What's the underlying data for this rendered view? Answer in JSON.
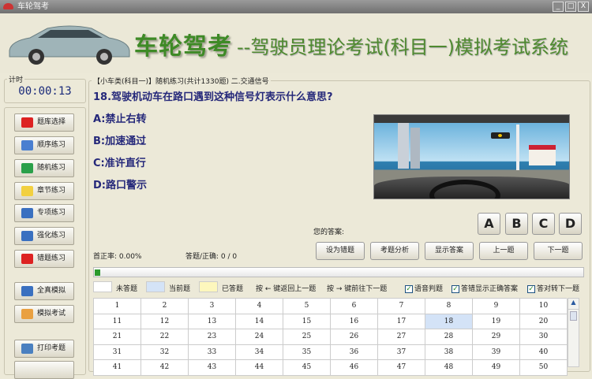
{
  "window": {
    "title": "车轮驾考",
    "min": "_",
    "max": "□",
    "close": "X"
  },
  "banner": {
    "brand": "车轮驾考",
    "subtitle": "--驾驶员理论考试(科目一)模拟考试系统"
  },
  "timer": {
    "label": "计时",
    "value": "00:00:13"
  },
  "sidebar": {
    "items": [
      {
        "label": "题库选择",
        "icon": "blocks-icon",
        "color": "#d22"
      },
      {
        "label": "顺序练习",
        "icon": "edit-icon",
        "color": "#4a7fd0"
      },
      {
        "label": "随机练习",
        "icon": "refresh-icon",
        "color": "#2aa04a"
      },
      {
        "label": "章节练习",
        "icon": "note-icon",
        "color": "#f2d040"
      },
      {
        "label": "专项练习",
        "icon": "checklist-icon",
        "color": "#3a70c0"
      },
      {
        "label": "强化练习",
        "icon": "chart-icon",
        "color": "#3a70c0"
      },
      {
        "label": "错题练习",
        "icon": "flag-icon",
        "color": "#d22"
      },
      {
        "label": "全真模拟",
        "icon": "chart-icon",
        "color": "#3a70c0"
      },
      {
        "label": "模拟考试",
        "icon": "calendar-icon",
        "color": "#e9a040"
      },
      {
        "label": "打印考题",
        "icon": "printer-icon",
        "color": "#4a80c0"
      }
    ]
  },
  "question": {
    "header": "【小车类(科目一)】随机练习(共计1330题) 二.交通信号",
    "text": "18.驾驶机动车在路口遇到这种信号灯表示什么意思?",
    "options": [
      "A:禁止右转",
      "B:加速通过",
      "C:准许直行",
      "D:路口警示"
    ]
  },
  "answer": {
    "label": "您的答案:",
    "choices": [
      "A",
      "B",
      "C",
      "D"
    ]
  },
  "actions": [
    "设为错题",
    "考题分析",
    "显示答案",
    "上一题",
    "下一题"
  ],
  "stats": {
    "accuracy": "首正率: 0.00%",
    "answered": "答题/正确: 0 / 0"
  },
  "progress": {
    "fraction": 0.01
  },
  "legend": {
    "unanswered": "未答题",
    "current": "当前题",
    "answered": "已答题",
    "prev_hint": "按 ← 键返回上一题",
    "next_hint": "按 → 键前往下一题",
    "checks": [
      {
        "label": "语音判题",
        "checked": true
      },
      {
        "label": "答错显示正确答案",
        "checked": true
      },
      {
        "label": "答对转下一题",
        "checked": true
      }
    ],
    "colors": {
      "unanswered": "#ffffff",
      "current": "#d4e3f7",
      "answered": "#fdf7bd"
    }
  },
  "grid": {
    "current": 18,
    "numbers": [
      1,
      2,
      3,
      4,
      5,
      6,
      7,
      8,
      9,
      10,
      11,
      12,
      13,
      14,
      15,
      16,
      17,
      18,
      19,
      20,
      21,
      22,
      23,
      24,
      25,
      26,
      27,
      28,
      29,
      30,
      31,
      32,
      33,
      34,
      35,
      36,
      37,
      38,
      39,
      40,
      41,
      42,
      43,
      44,
      45,
      46,
      47,
      48,
      49,
      50
    ]
  }
}
